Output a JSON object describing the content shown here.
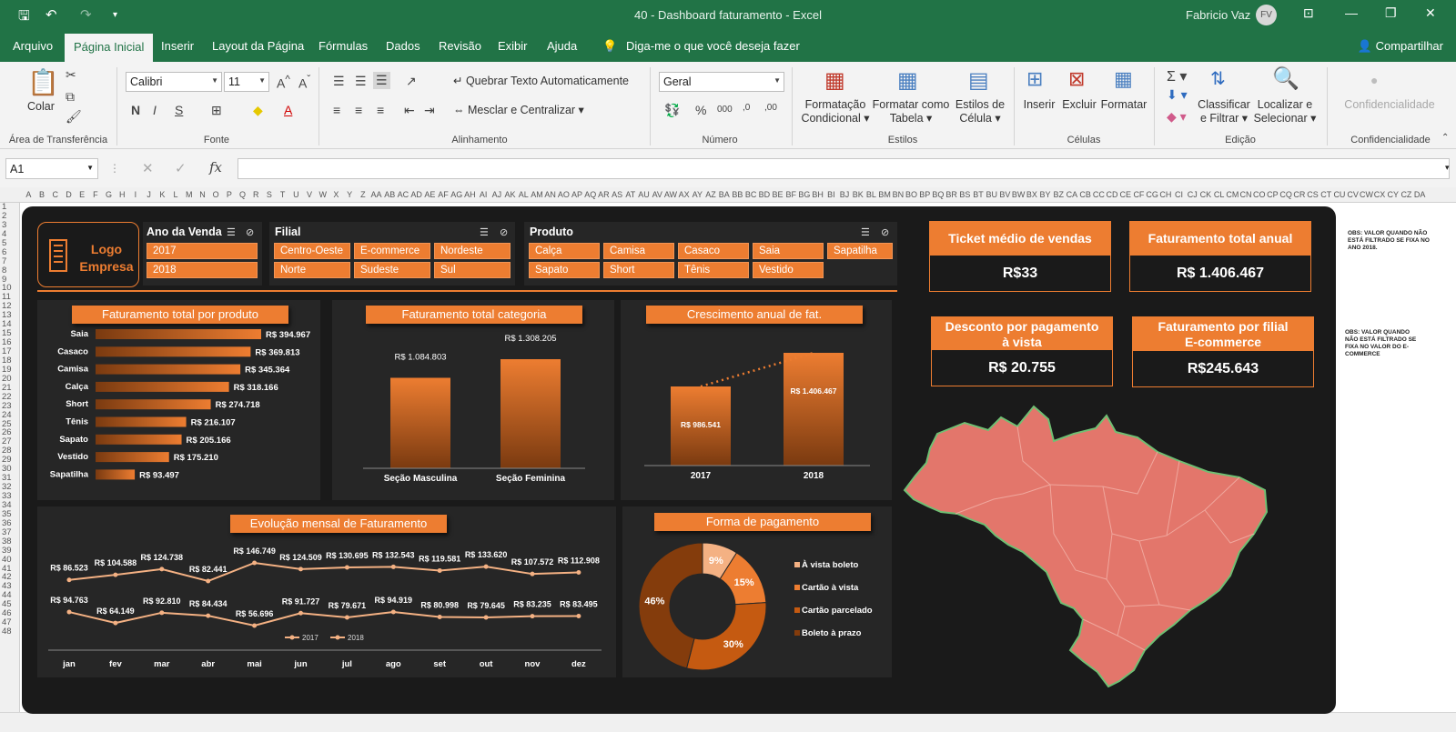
{
  "window": {
    "title": "40 - Dashboard faturamento  -  Excel",
    "user": "Fabricio Vaz",
    "initials": "FV"
  },
  "menu": {
    "tabs": [
      "Arquivo",
      "Página Inicial",
      "Inserir",
      "Layout da Página",
      "Fórmulas",
      "Dados",
      "Revisão",
      "Exibir",
      "Ajuda"
    ],
    "tell_me": "Diga-me o que você deseja fazer",
    "share": "Compartilhar"
  },
  "ribbon": {
    "paste": "Colar",
    "font_name": "Calibri",
    "font_size": "11",
    "wrap_text": "Quebrar Texto Automaticamente",
    "merge_center": "Mesclar e Centralizar",
    "number_format": "Geral",
    "cond_format": [
      "Formatação",
      "Condicional"
    ],
    "format_table": [
      "Formatar como",
      "Tabela"
    ],
    "cell_styles": [
      "Estilos de",
      "Célula"
    ],
    "insert": "Inserir",
    "delete": "Excluir",
    "format": "Formatar",
    "sort_filter": [
      "Classificar",
      "e Filtrar"
    ],
    "find_select": [
      "Localizar e",
      "Selecionar"
    ],
    "confidential": "Confidencialidade",
    "groups": [
      "Área de Transferência",
      "Fonte",
      "Alinhamento",
      "Número",
      "Estilos",
      "Células",
      "Edição",
      "Confidencialidade"
    ]
  },
  "formula_bar": {
    "name_box": "A1",
    "fx": "fx"
  },
  "columns": [
    "A",
    "B",
    "C",
    "D",
    "E",
    "F",
    "G",
    "H",
    "I",
    "J",
    "K",
    "L",
    "M",
    "N",
    "O",
    "P",
    "Q",
    "R",
    "S",
    "T",
    "U",
    "V",
    "W",
    "X",
    "Y",
    "Z",
    "AA",
    "AB",
    "AC",
    "AD",
    "AE",
    "AF",
    "AG",
    "AH",
    "AI",
    "AJ",
    "AK",
    "AL",
    "AM",
    "AN",
    "AO",
    "AP",
    "AQ",
    "AR",
    "AS",
    "AT",
    "AU",
    "AV",
    "AW",
    "AX",
    "AY",
    "AZ",
    "BA",
    "BB",
    "BC",
    "BD",
    "BE",
    "BF",
    "BG",
    "BH",
    "BI",
    "BJ",
    "BK",
    "BL",
    "BM",
    "BN",
    "BO",
    "BP",
    "BQ",
    "BR",
    "BS",
    "BT",
    "BU",
    "BV",
    "BW",
    "BX",
    "BY",
    "BZ",
    "CA",
    "CB",
    "CC",
    "CD",
    "CE",
    "CF",
    "CG",
    "CH",
    "CI",
    "CJ",
    "CK",
    "CL",
    "CM",
    "CN",
    "CO",
    "CP",
    "CQ",
    "CR",
    "CS",
    "CT",
    "CU",
    "CV",
    "CW",
    "CX",
    "CY",
    "CZ",
    "DA"
  ],
  "rows": [
    "1",
    "2",
    "3",
    "4",
    "5",
    "6",
    "7",
    "8",
    "9",
    "10",
    "11",
    "12",
    "13",
    "14",
    "15",
    "16",
    "17",
    "18",
    "19",
    "20",
    "21",
    "22",
    "23",
    "24",
    "25",
    "26",
    "27",
    "28",
    "29",
    "30",
    "31",
    "32",
    "33",
    "34",
    "35",
    "36",
    "37",
    "38",
    "39",
    "40",
    "41",
    "42",
    "43",
    "44",
    "45",
    "46",
    "47",
    "48"
  ],
  "dashboard": {
    "logo": [
      "Logo",
      "Empresa"
    ],
    "slicers": {
      "ano": {
        "title": "Ano da Venda",
        "items": [
          "2017",
          "2018"
        ]
      },
      "filial": {
        "title": "Filial",
        "items": [
          "Centro-Oeste",
          "E-commerce",
          "Nordeste",
          "Norte",
          "Sudeste",
          "Sul"
        ]
      },
      "produto": {
        "title": "Produto",
        "items": [
          "Calça",
          "Camisa",
          "Casaco",
          "Saia",
          "Sapatilha",
          "Sapato",
          "Short",
          "Tênis",
          "Vestido"
        ]
      }
    },
    "kpis": {
      "ticket": {
        "label": "Ticket médio de vendas",
        "value": "R$33"
      },
      "total_anual": {
        "label": "Faturamento total anual",
        "value": "R$ 1.406.467"
      },
      "desconto": {
        "label": "Desconto por pagamento à vista",
        "value": "R$ 20.755"
      },
      "filial": {
        "label": "Faturamento por filial E-commerce",
        "value": "R$245.643"
      }
    },
    "notes": [
      "OBS: VALOR QUANDO NÃO ESTÁ FILTRADO SE FIXA NO ANO 2018.",
      "OBS: VALOR QUANDO NÃO ESTÁ FILTRADO SE FIXA NO VALOR DO E-COMMERCE"
    ],
    "accent": "#ed7d31",
    "map_color": "#e3766b"
  },
  "chart_data": [
    {
      "type": "bar",
      "orientation": "horizontal",
      "title": "Faturamento total por produto",
      "categories": [
        "Saia",
        "Casaco",
        "Camisa",
        "Calça",
        "Short",
        "Tênis",
        "Sapato",
        "Vestido",
        "Sapatilha"
      ],
      "values": [
        394967,
        369813,
        345364,
        318166,
        274718,
        216107,
        205166,
        175210,
        93497
      ],
      "labels": [
        "R$ 394.967",
        "R$ 369.813",
        "R$ 345.364",
        "R$ 318.166",
        "R$ 274.718",
        "R$ 216.107",
        "R$ 205.166",
        "R$ 175.210",
        "R$ 93.497"
      ]
    },
    {
      "type": "bar",
      "title": "Faturamento total categoria",
      "categories": [
        "Seção Masculina",
        "Seção Feminina"
      ],
      "values": [
        1084803,
        1308205
      ],
      "labels": [
        "R$ 1.084.803",
        "R$ 1.308.205"
      ]
    },
    {
      "type": "bar",
      "title": "Crescimento anual de fat.",
      "categories": [
        "2017",
        "2018"
      ],
      "values": [
        986541,
        1406467
      ],
      "labels": [
        "R$ 986.541",
        "R$ 1.406.467"
      ],
      "trendline": true
    },
    {
      "type": "line",
      "title": "Evolução mensal de Faturamento",
      "categories": [
        "jan",
        "fev",
        "mar",
        "abr",
        "mai",
        "jun",
        "jul",
        "ago",
        "set",
        "out",
        "nov",
        "dez"
      ],
      "series": [
        {
          "name": "2017",
          "values": [
            94763,
            64149,
            92810,
            84434,
            56696,
            91727,
            79671,
            94919,
            80998,
            79645,
            83235,
            83495
          ],
          "labels": [
            "R$ 94.763",
            "R$ 64.149",
            "R$ 92.810",
            "R$ 84.434",
            "R$ 56.696",
            "R$ 91.727",
            "R$ 79.671",
            "R$ 94.919",
            "R$ 80.998",
            "R$ 79.645",
            "R$ 83.235",
            "R$ 83.495"
          ]
        },
        {
          "name": "2018",
          "values": [
            86523,
            104588,
            124738,
            82441,
            146749,
            124509,
            130695,
            132543,
            119581,
            133620,
            107572,
            112908
          ],
          "labels": [
            "R$ 86.523",
            "R$ 104.588",
            "R$ 124.738",
            "R$ 82.441",
            "R$ 146.749",
            "R$ 124.509",
            "R$ 130.695",
            "R$ 132.543",
            "R$ 119.581",
            "R$ 133.620",
            "R$ 107.572",
            "R$ 112.908"
          ]
        }
      ],
      "legend": "bottom-right"
    },
    {
      "type": "pie",
      "donut": true,
      "title": "Forma de pagamento",
      "categories": [
        "À vista boleto",
        "Cartão à vista",
        "Cartão parcelado",
        "Boleto à prazo"
      ],
      "values": [
        9,
        15,
        30,
        46
      ],
      "labels": [
        "9%",
        "15%",
        "30%",
        "46%"
      ],
      "colors": [
        "#f4b183",
        "#ed7d31",
        "#c55a11",
        "#843c0c"
      ],
      "legend": "right"
    }
  ]
}
